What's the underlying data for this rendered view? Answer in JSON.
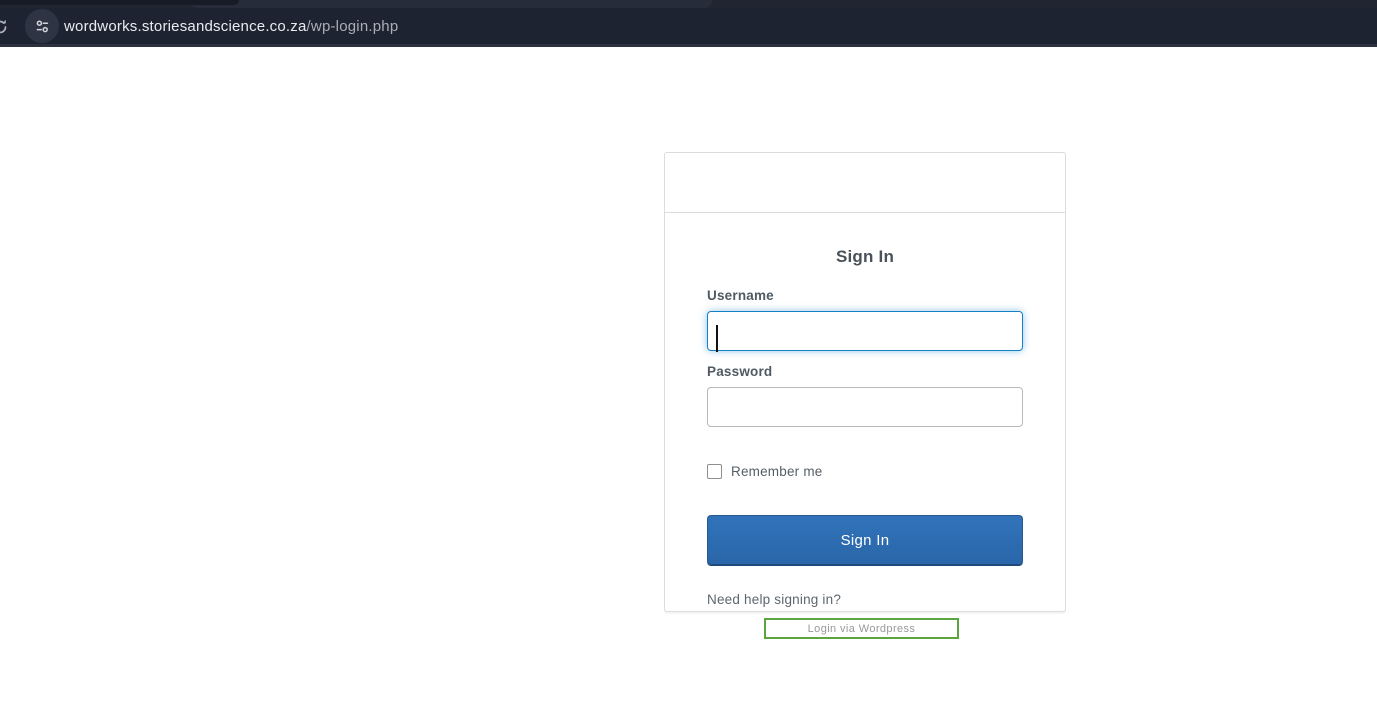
{
  "browser": {
    "address": {
      "domain": "wordworks.storiesandscience.co.za",
      "path": "/wp-login.php"
    },
    "icons": {
      "site_settings": "tune-icon",
      "reload": "reload-icon"
    }
  },
  "page": {
    "card": {
      "title": "Sign In",
      "username": {
        "label": "Username",
        "value": "",
        "placeholder": ""
      },
      "password": {
        "label": "Password",
        "value": "",
        "placeholder": ""
      },
      "remember_me_label": "Remember me",
      "sign_in_button_label": "Sign In",
      "help_link_label": "Need help signing in?"
    },
    "wordpress_button_label": "Login via Wordpress"
  },
  "colors": {
    "chrome_toolbar_bg": "#1d2330",
    "primary_button_blue": "#2d6cb2",
    "focus_border_blue": "#1780c4",
    "wordpress_button_green": "#5aa53f"
  }
}
